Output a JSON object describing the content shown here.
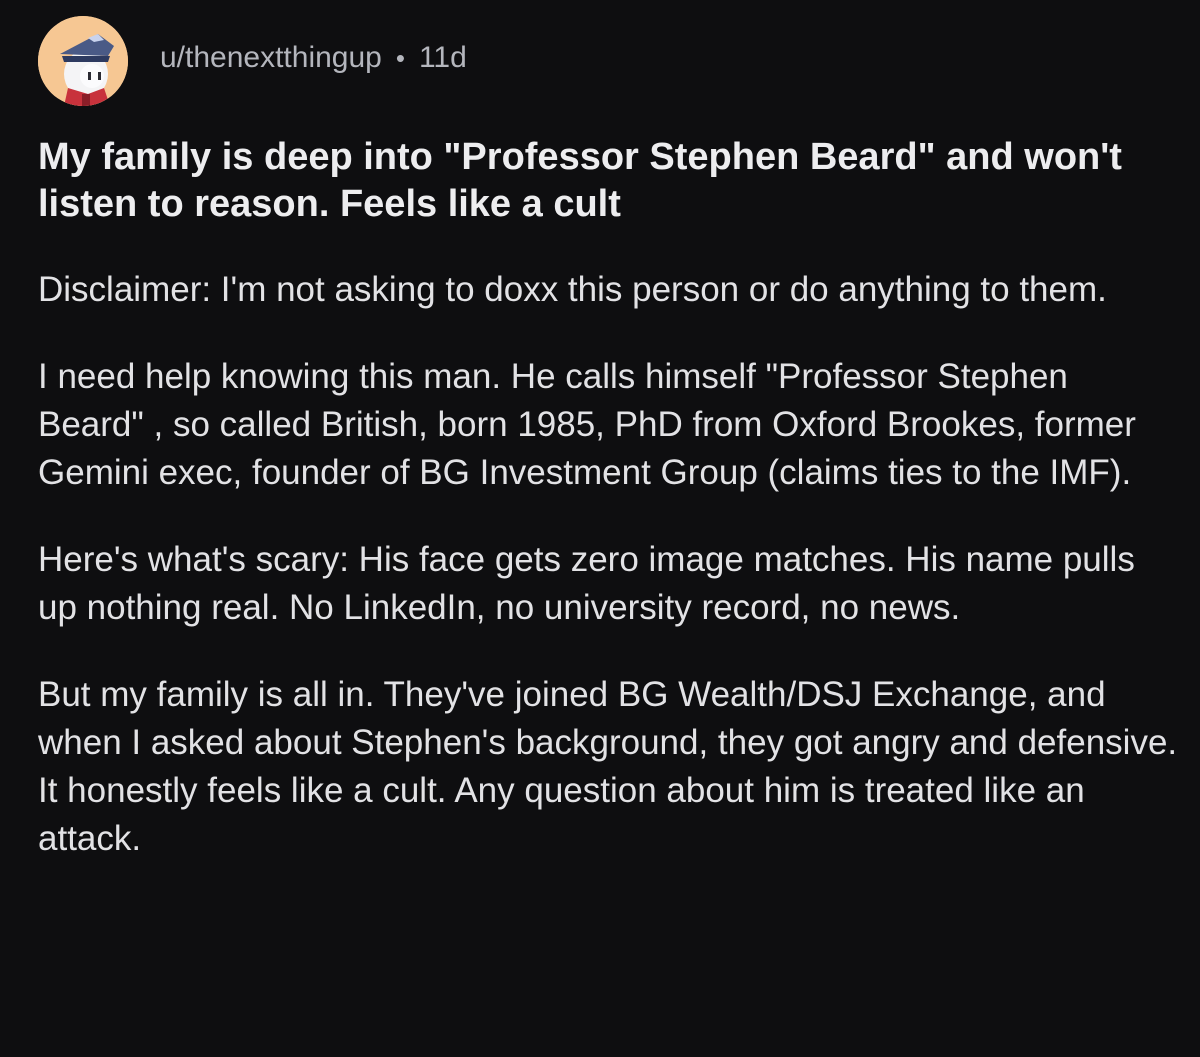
{
  "post": {
    "author": "u/thenextthingup",
    "separator": "•",
    "age": "11d",
    "title": "My family is deep into \"Professor Stephen Beard\" and won't listen to reason. Feels like a cult",
    "paragraphs": [
      "Disclaimer: I'm not asking to doxx this person or do anything to them.",
      "I need help knowing this man. He calls himself \"Professor Stephen Beard\" , so called British, born 1985, PhD from Oxford Brookes, former Gemini exec, founder of BG Investment Group (claims ties to the IMF).",
      "Here's what's scary: His face gets zero image matches. His name pulls up nothing real. No LinkedIn, no university record, no news.",
      "But my family is all in. They've joined BG Wealth/DSJ Exchange, and when I asked about Stephen's background, they got angry and defensive. It honestly feels like a cult. Any question about him is treated like an attack."
    ]
  }
}
